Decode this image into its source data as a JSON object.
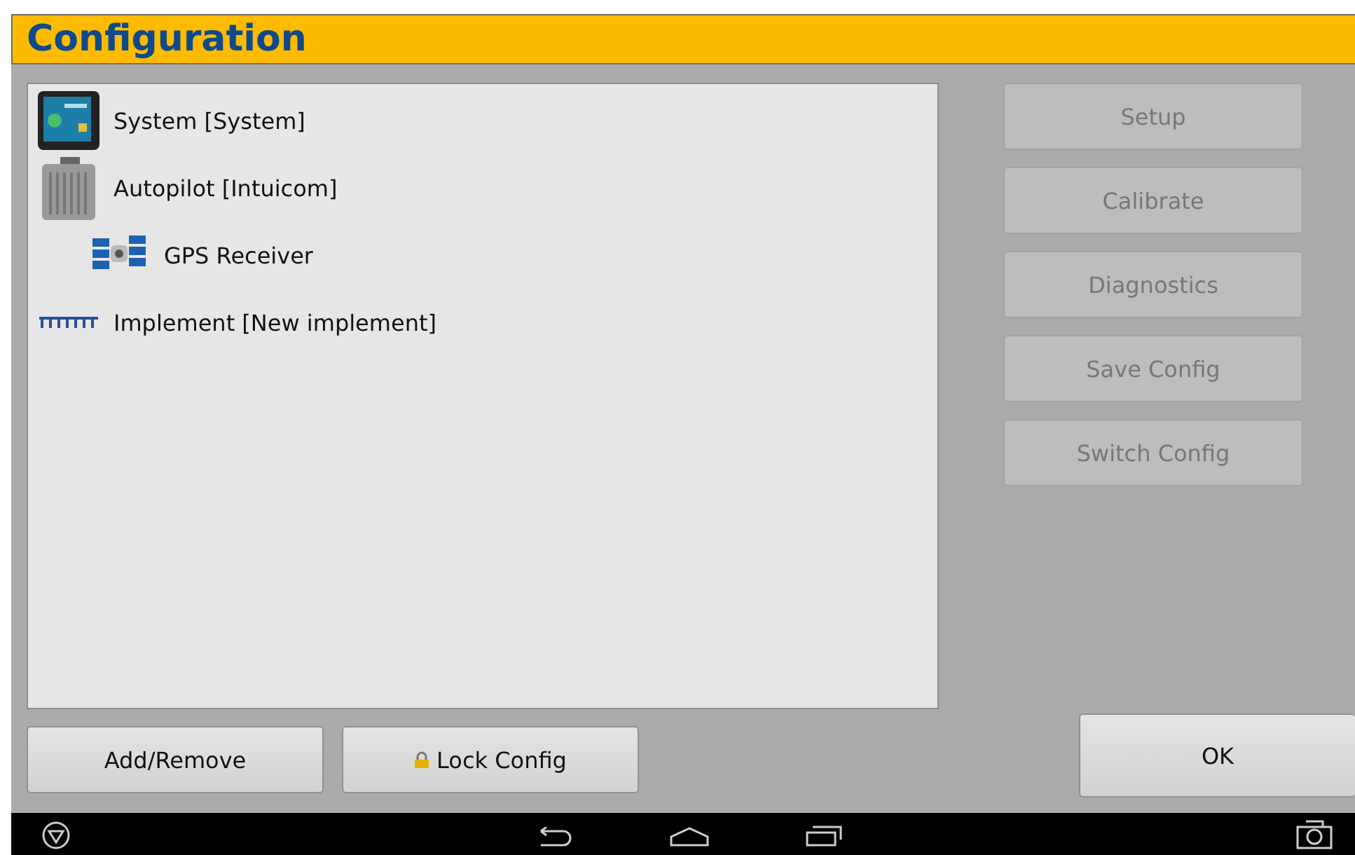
{
  "window": {
    "title": "Configuration"
  },
  "tree": [
    {
      "label": "System [System]",
      "kind": "display"
    },
    {
      "label": "Autopilot [Intuicom]",
      "kind": "controller",
      "children": [
        {
          "label": "GPS Receiver",
          "kind": "satellite"
        }
      ]
    },
    {
      "label": "Implement [New implement]",
      "kind": "implement"
    }
  ],
  "side_buttons": [
    {
      "label": "Setup",
      "disabled": true
    },
    {
      "label": "Calibrate",
      "disabled": true
    },
    {
      "label": "Diagnostics",
      "disabled": true
    },
    {
      "label": "Save Config",
      "disabled": true
    },
    {
      "label": "Switch Config",
      "disabled": true
    }
  ],
  "bottom_buttons": [
    {
      "label": "Add/Remove",
      "kind": "plain"
    },
    {
      "label": "Lock Config",
      "kind": "lock"
    }
  ],
  "ok_button": {
    "label": "OK"
  }
}
